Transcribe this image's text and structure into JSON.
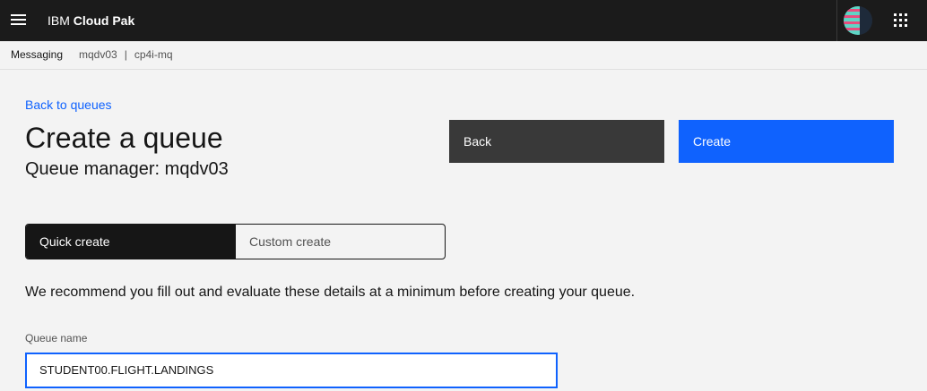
{
  "header": {
    "brand_prefix": "IBM",
    "brand_name": "Cloud Pak",
    "menu_icon": "hamburger-menu-icon",
    "avatar_icon": "user-avatar-icon",
    "switcher_icon": "app-switcher-grid-icon"
  },
  "breadcrumb": {
    "root": "Messaging",
    "instance": "mqdv03",
    "separator": "|",
    "namespace": "cp4i-mq"
  },
  "page": {
    "back_link": "Back to queues",
    "title": "Create a queue",
    "subtitle": "Queue manager: mqdv03"
  },
  "actions": {
    "back_label": "Back",
    "create_label": "Create"
  },
  "mode_switch": {
    "quick_label": "Quick create",
    "custom_label": "Custom create",
    "selected": "Quick create"
  },
  "form": {
    "helper_text": "We recommend you fill out and evaluate these details at a minimum before creating your queue.",
    "queue_name_label": "Queue name",
    "queue_name_value": "STUDENT00.FLIGHT.LANDINGS"
  },
  "colors": {
    "accent": "#0f62fe",
    "topbar": "#1b1b1b",
    "background": "#f3f3f3",
    "secondary_button": "#393939"
  }
}
